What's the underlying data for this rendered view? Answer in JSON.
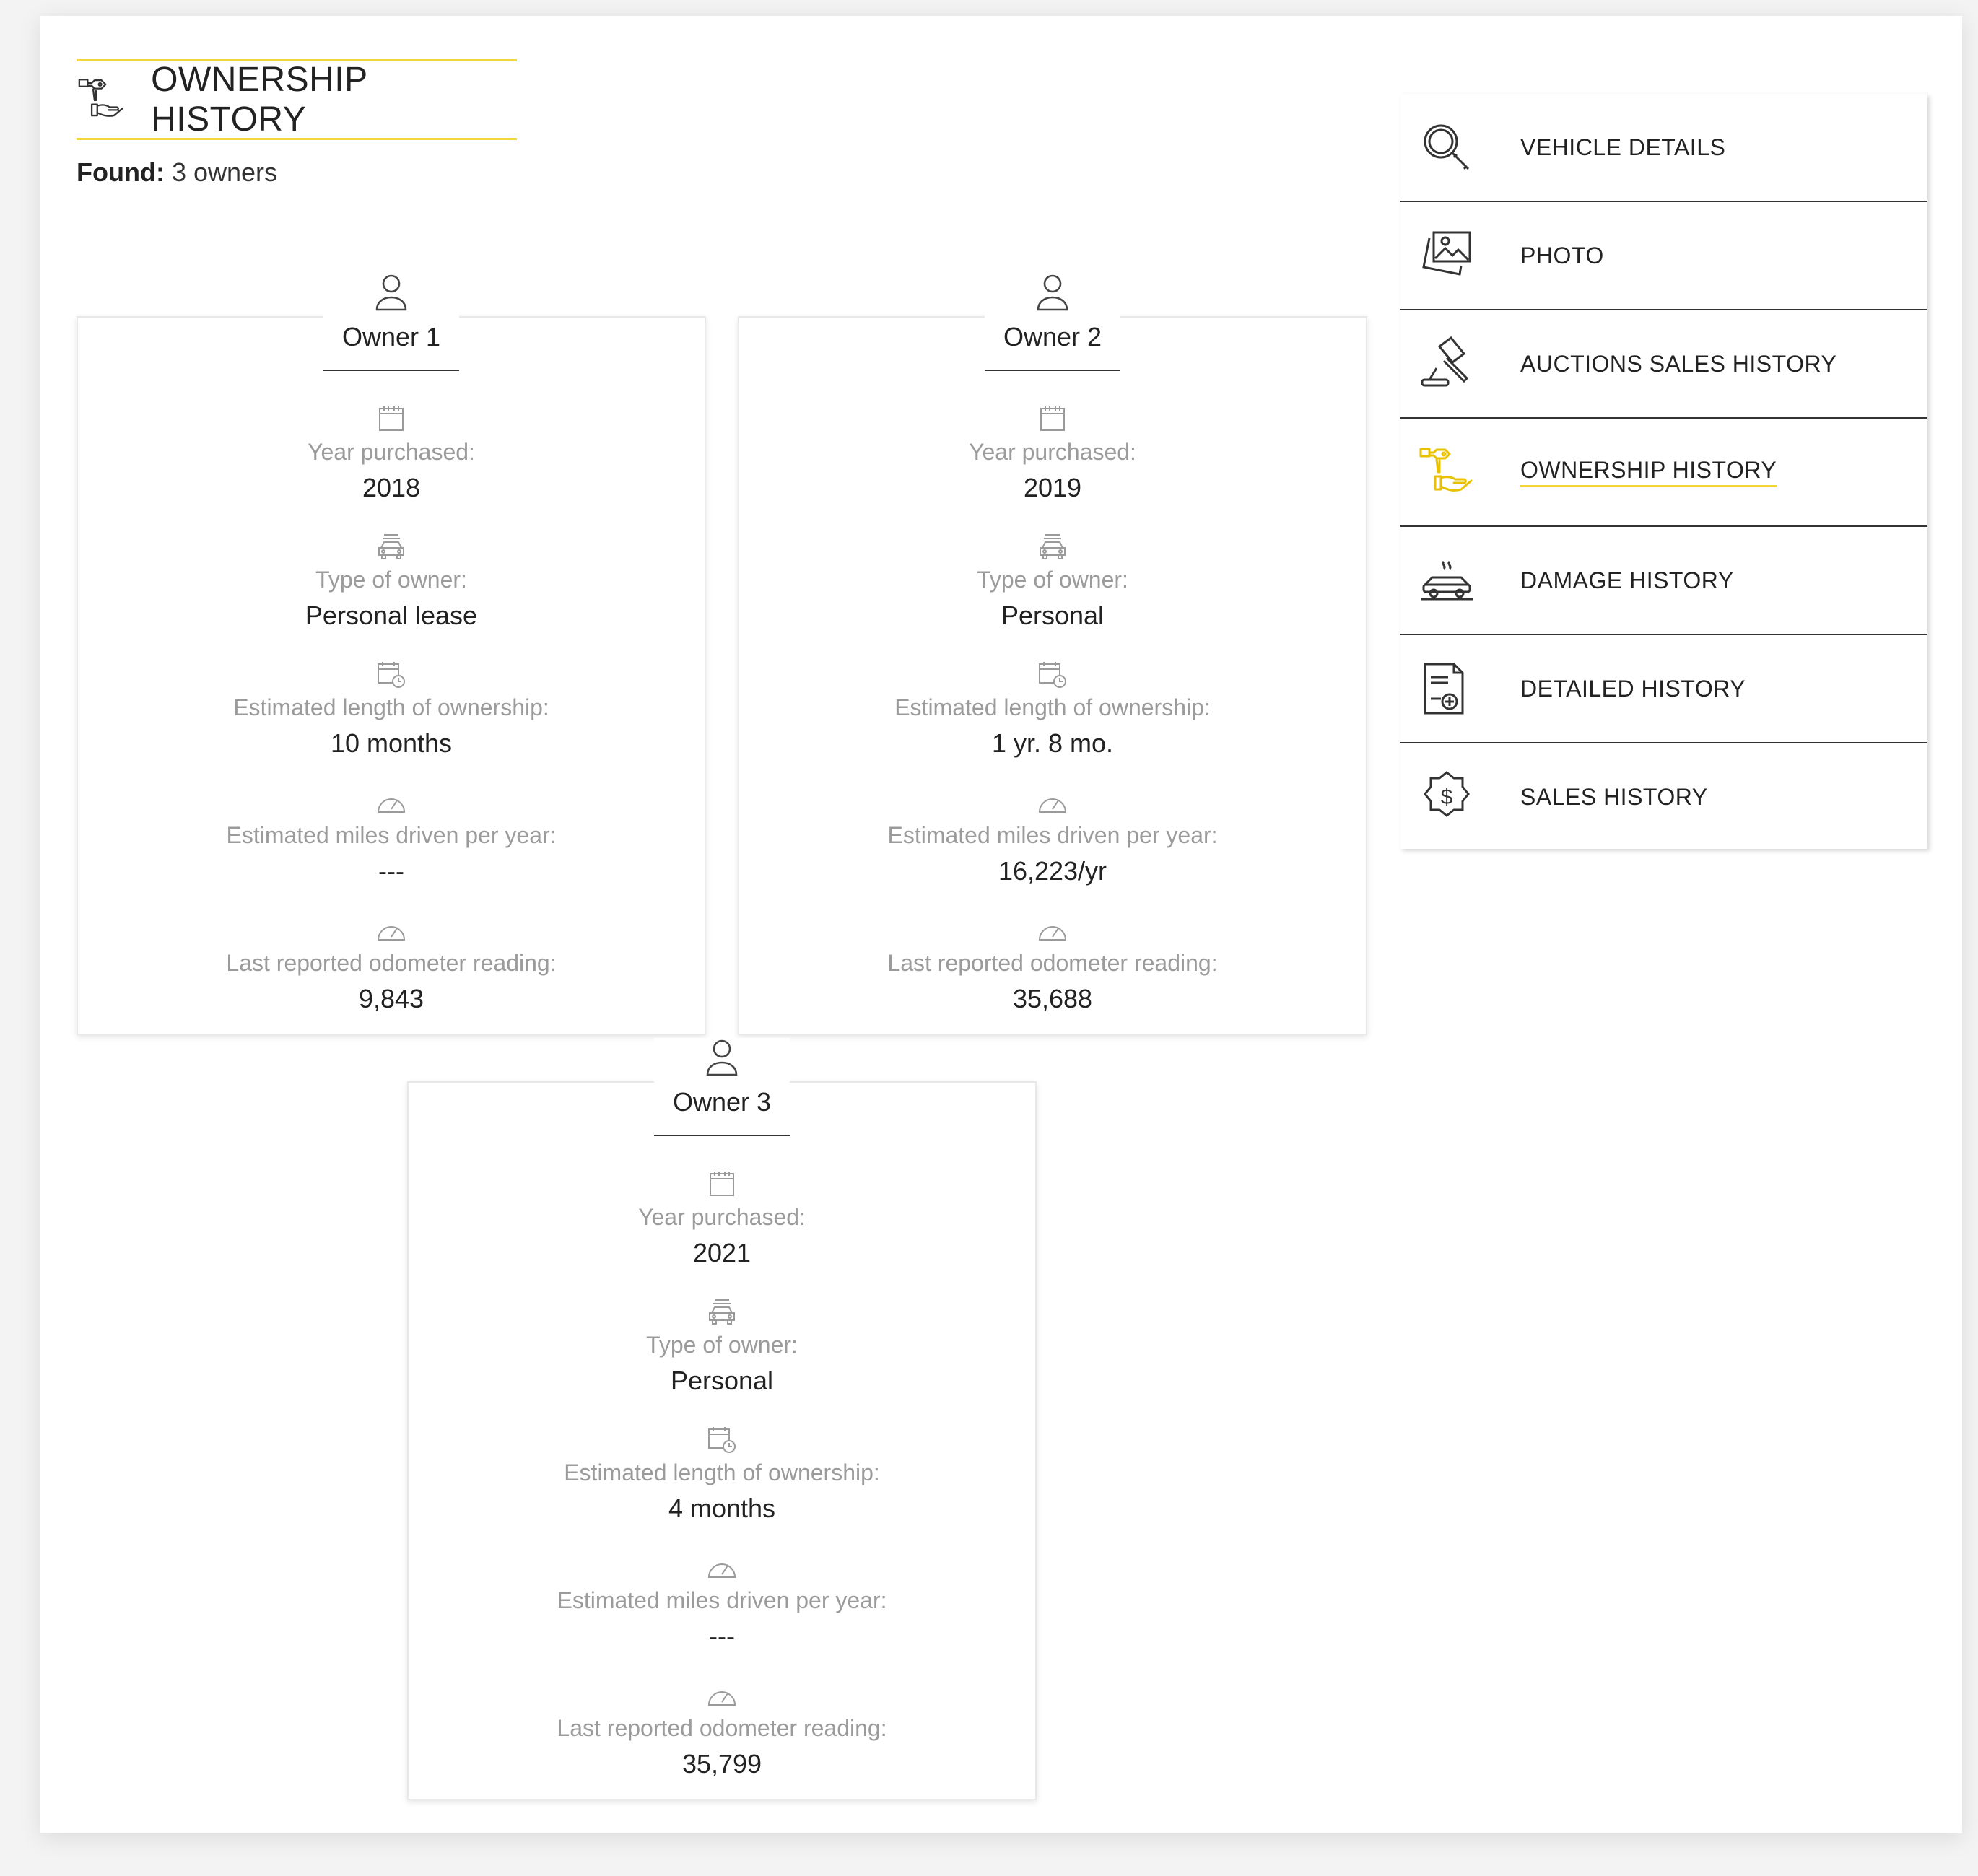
{
  "header": {
    "title": "OWNERSHIP HISTORY"
  },
  "found": {
    "label": "Found:",
    "value": "3 owners"
  },
  "owners": [
    {
      "name": "Owner 1",
      "year_label": "Year purchased:",
      "year": "2018",
      "type_label": "Type of owner:",
      "type": "Personal lease",
      "length_label": "Estimated length of ownership:",
      "length": "10 months",
      "miles_label": "Estimated miles driven per year:",
      "miles": "---",
      "odo_label": "Last reported odometer reading:",
      "odo": "9,843"
    },
    {
      "name": "Owner 2",
      "year_label": "Year purchased:",
      "year": "2019",
      "type_label": "Type of owner:",
      "type": "Personal",
      "length_label": "Estimated length of ownership:",
      "length": "1 yr. 8 mo.",
      "miles_label": "Estimated miles driven per year:",
      "miles": "16,223/yr",
      "odo_label": "Last reported odometer reading:",
      "odo": "35,688"
    },
    {
      "name": "Owner 3",
      "year_label": "Year purchased:",
      "year": "2021",
      "type_label": "Type of owner:",
      "type": "Personal",
      "length_label": "Estimated length of ownership:",
      "length": "4 months",
      "miles_label": "Estimated miles driven per year:",
      "miles": "---",
      "odo_label": "Last reported odometer reading:",
      "odo": "35,799"
    }
  ],
  "nav": [
    {
      "label": "VEHICLE DETAILS",
      "icon": "magnifier-icon",
      "active": false
    },
    {
      "label": "PHOTO",
      "icon": "photo-icon",
      "active": false
    },
    {
      "label": "AUCTIONS SALES HISTORY",
      "icon": "gavel-icon",
      "active": false
    },
    {
      "label": "OWNERSHIP HISTORY",
      "icon": "key-hand-icon",
      "active": true
    },
    {
      "label": "DAMAGE HISTORY",
      "icon": "damaged-car-icon",
      "active": false
    },
    {
      "label": "DETAILED HISTORY",
      "icon": "document-plus-icon",
      "active": false
    },
    {
      "label": "SALES HISTORY",
      "icon": "dollar-badge-icon",
      "active": false
    }
  ],
  "colors": {
    "accent": "#f2d63a",
    "muted_text": "#9b9b9b",
    "text": "#222222"
  }
}
